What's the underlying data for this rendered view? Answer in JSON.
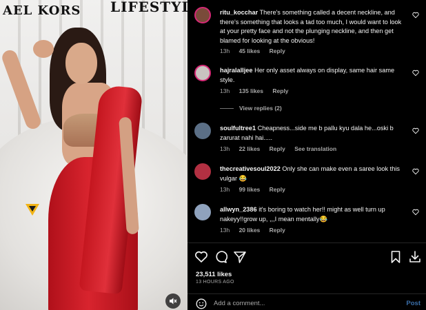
{
  "media": {
    "brand_left": "AEL KORS",
    "brand_right": "LIFESTYL",
    "watermark_logo": "v-logo-icon",
    "mute_icon": "speaker-muted-icon"
  },
  "comments": [
    {
      "username": "ritu_kocchar",
      "text": "There's something called a decent neckline, and there's something that looks a tad too much, I would want to look at your pretty face and not the plunging neckline, and then get blamed for looking at the obvious!",
      "time": "13h",
      "likes": "45 likes",
      "reply": "Reply",
      "avatar_color": "#7a4b3a"
    },
    {
      "username": "hajralalljee",
      "text": "Her only asset always on display, same hair same style.",
      "time": "13h",
      "likes": "135 likes",
      "reply": "Reply",
      "view_replies": "View replies (2)",
      "avatar_color": "#c9c3c0"
    },
    {
      "username": "soulfultree1",
      "text": "Cheapness...side me b pallu kyu dala he...oski b zarurat nahi hai.....",
      "time": "13h",
      "likes": "22 likes",
      "reply": "Reply",
      "extra": "See translation",
      "avatar_color": "#5b6f86"
    },
    {
      "username": "thecreativesoul2022",
      "text": "Only she can make even a saree look this vulgar 😂",
      "time": "13h",
      "likes": "99 likes",
      "reply": "Reply",
      "avatar_color": "#b23042"
    },
    {
      "username": "allwyn_2386",
      "text": "it's boring to watch her!! might as well turn up nakeyy!!grow up, ,,,I mean mentally😂",
      "time": "13h",
      "likes": "20 likes",
      "reply": "Reply",
      "avatar_color": "#8fa2bd"
    }
  ],
  "actions": {
    "like_icon": "heart-icon",
    "comment_icon": "comment-icon",
    "share_icon": "send-icon",
    "save_icon": "bookmark-icon",
    "download_icon": "download-icon"
  },
  "post": {
    "likes": "23,511 likes",
    "time_ago": "13 HOURS AGO"
  },
  "add_comment": {
    "placeholder": "Add a comment...",
    "post_label": "Post"
  },
  "colors": {
    "saree_red": "#c4161f",
    "post_button": "#3a6ea8",
    "meta_grey": "#a8a8a8"
  }
}
